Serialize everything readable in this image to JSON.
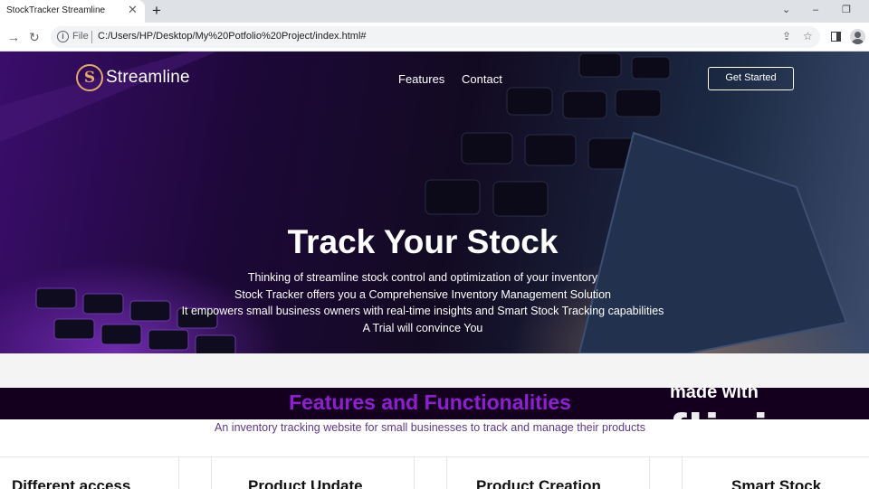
{
  "browser": {
    "tab_title": "StockTracker Streamline",
    "tab_close": "✕",
    "new_tab": "+",
    "scheme_label": "File",
    "url": "C:/Users/HP/Desktop/My%20Potfolio%20Project/index.html#",
    "window_controls": [
      "⌄",
      "–",
      "❐"
    ],
    "icons": [
      "back-arrow-icon",
      "reload-icon",
      "info-icon",
      "share-icon",
      "star-icon",
      "side-panel-icon",
      "profile-icon"
    ]
  },
  "site": {
    "brand": "Streamline",
    "logo_letter": "S",
    "nav": [
      "Features",
      "Contact"
    ],
    "cta": "Get Started",
    "hero_title": "Track Your Stock",
    "hero_lines": [
      "Thinking of streamline stock control and optimization of your inventory",
      "Stock Tracker offers you a Comprehensive Inventory Management Solution",
      "It empowers small business owners with real-time insights and Smart Stock Tracking capabilities",
      "A Trial will convince You"
    ],
    "features_title": "Features and Functionalities",
    "features_subtitle": "An inventory tracking website for small businesses to track and manage their products",
    "cards": [
      "Different access",
      "Product Update",
      "Product Creation",
      "Smart Stock"
    ]
  },
  "watermark": {
    "line1": "made with",
    "line2": "flixier"
  },
  "colors": {
    "accent_purple": "#8e1fd0",
    "logo_gold": "#e3a86b",
    "features_header_bg": "#14001e"
  }
}
